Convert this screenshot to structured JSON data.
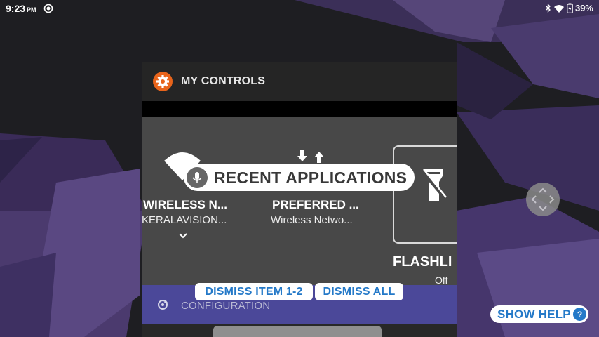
{
  "status_bar": {
    "time": "9:23",
    "ampm": "PM",
    "battery_percent": "39%",
    "icons": [
      "sync-icon",
      "bluetooth-icon",
      "wifi-icon",
      "battery-charging-icon"
    ]
  },
  "recent_card": {
    "title": "MY CONTROLS",
    "icon": "gear-icon",
    "accent_color": "#e8641b",
    "tiles": [
      {
        "title": "WIRELESS N...",
        "subtitle": "KERALAVISION...",
        "icon": "wifi-icon",
        "expand_icon": "chevron-down-icon"
      },
      {
        "title": "PREFERRED ...",
        "subtitle": "Wireless Netwo...",
        "icon": "data-transfer-icon"
      },
      {
        "title": "FLASHLI",
        "subtitle": "Off",
        "icon": "flashlight-off-icon"
      }
    ],
    "config_bar": {
      "label": "CONFIGURATION",
      "icon": "refresh-icon",
      "color": "#4b4899"
    }
  },
  "overlay": {
    "recent_applications_label": "RECENT APPLICATIONS",
    "mic_icon": "microphone-icon",
    "dismiss_item_label": "DISMISS ITEM 1-2",
    "dismiss_all_label": "DISMISS ALL",
    "show_help_label": "SHOW HELP",
    "help_badge": "?",
    "chip_text_color": "#2479c8"
  },
  "navigation": {
    "dpad_icon": "navigation-arrows-icon"
  }
}
